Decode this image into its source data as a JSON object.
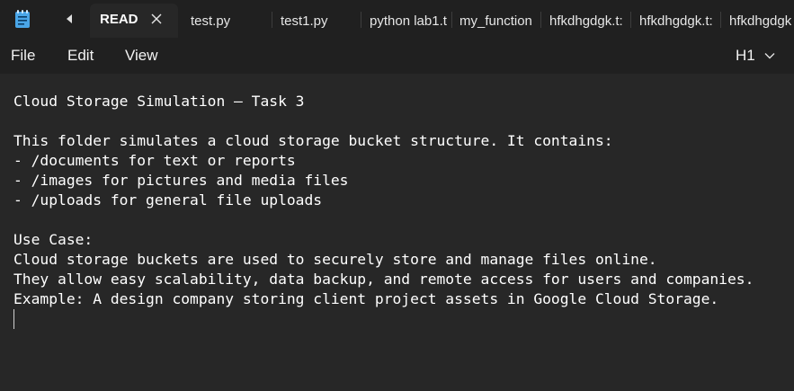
{
  "tabs": [
    {
      "label": "READ",
      "active": true
    },
    {
      "label": "test.py"
    },
    {
      "label": "test1.py"
    },
    {
      "label": "python lab1.t"
    },
    {
      "label": "my_function"
    },
    {
      "label": "hfkdhgdgk.t:"
    },
    {
      "label": "hfkdhgdgk.t:"
    },
    {
      "label": "hfkdhgdgk"
    }
  ],
  "menu": {
    "file": "File",
    "edit": "Edit",
    "view": "View",
    "heading_value": "H1"
  },
  "icons": {
    "app": "notepad-icon",
    "scroll_left": "caret-left-icon",
    "close": "close-icon",
    "dropdown": "chevron-down-icon"
  },
  "colors": {
    "background": "#272727",
    "chrome": "#202020",
    "text": "#ffffff",
    "app_icon": "#4aa6e8"
  },
  "document": {
    "lines": [
      "Cloud Storage Simulation – Task 3",
      "",
      "This folder simulates a cloud storage bucket structure. It contains:",
      "- /documents for text or reports",
      "- /images for pictures and media files",
      "- /uploads for general file uploads",
      "",
      "Use Case:",
      "Cloud storage buckets are used to securely store and manage files online.",
      "They allow easy scalability, data backup, and remote access for users and companies.",
      "Example: A design company storing client project assets in Google Cloud Storage."
    ]
  }
}
